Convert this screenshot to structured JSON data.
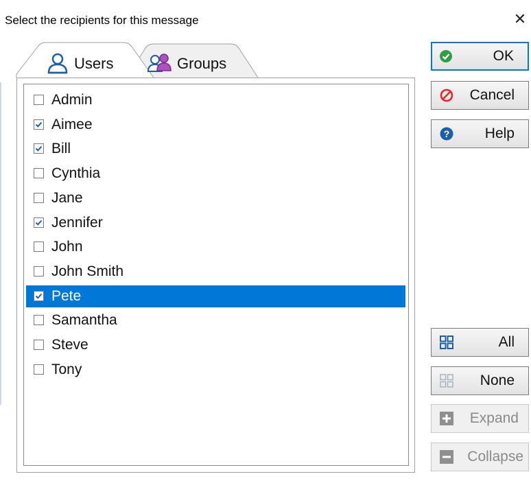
{
  "dialog": {
    "title": "Select the recipients for this message",
    "close_glyph": "✕"
  },
  "tabs": [
    {
      "label": "Users",
      "icon": "user-icon",
      "active": true
    },
    {
      "label": "Groups",
      "icon": "group-icon",
      "active": false
    }
  ],
  "recipients": [
    {
      "name": "Admin",
      "checked": false,
      "selected": false
    },
    {
      "name": "Aimee",
      "checked": true,
      "selected": false
    },
    {
      "name": "Bill",
      "checked": true,
      "selected": false
    },
    {
      "name": "Cynthia",
      "checked": false,
      "selected": false
    },
    {
      "name": "Jane",
      "checked": false,
      "selected": false
    },
    {
      "name": "Jennifer",
      "checked": true,
      "selected": false
    },
    {
      "name": "John",
      "checked": false,
      "selected": false
    },
    {
      "name": "John Smith",
      "checked": false,
      "selected": false
    },
    {
      "name": "Pete",
      "checked": true,
      "selected": true
    },
    {
      "name": "Samantha",
      "checked": false,
      "selected": false
    },
    {
      "name": "Steve",
      "checked": false,
      "selected": false
    },
    {
      "name": "Tony",
      "checked": false,
      "selected": false
    }
  ],
  "buttons": {
    "ok": {
      "label": "OK",
      "icon": "check-circle-icon",
      "color": "#2e9e44"
    },
    "cancel": {
      "label": "Cancel",
      "icon": "no-entry-icon",
      "color": "#e0282e"
    },
    "help": {
      "label": "Help",
      "icon": "help-circle-icon",
      "color": "#1b5fa8"
    },
    "all": {
      "label": "All",
      "icon": "grid-icon",
      "color": "#1b5fa8"
    },
    "none": {
      "label": "None",
      "icon": "grid-outline-icon",
      "color": "#9aa6b8"
    },
    "expand": {
      "label": "Expand",
      "icon": "plus-box-icon",
      "disabled": true
    },
    "collapse": {
      "label": "Collapse",
      "icon": "minus-box-icon",
      "disabled": true
    }
  },
  "colors": {
    "selection": "#0078d7",
    "check": "#1a5fb4"
  }
}
